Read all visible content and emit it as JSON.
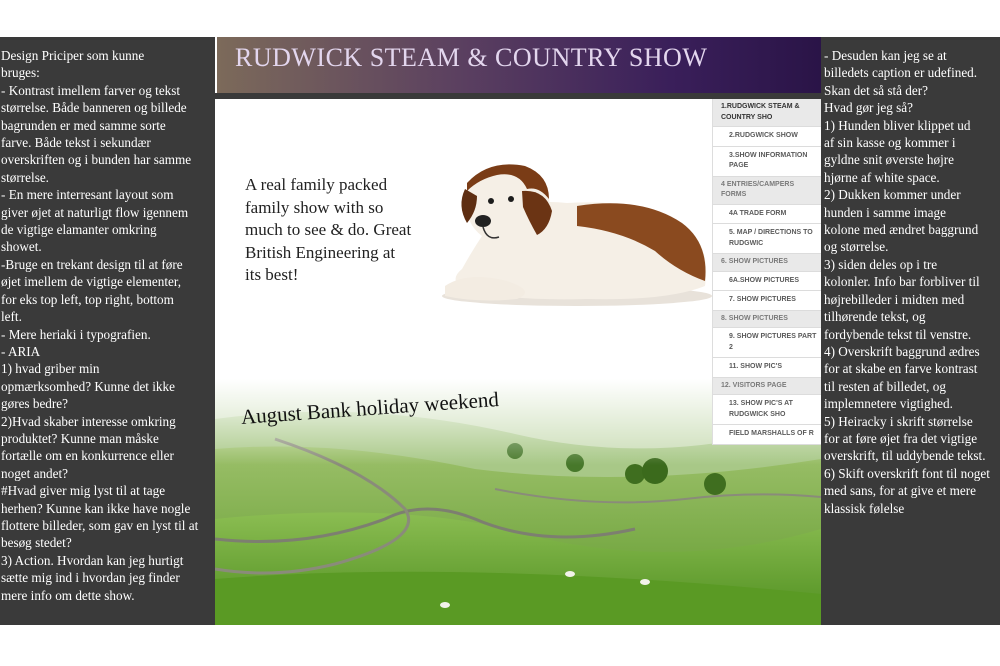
{
  "left_notes": {
    "text": "Design Priciper som kunne\nbruges:\n- Kontrast imellem farver og tekst\nstørrelse. Både banneren og billede\nbagrunden er med samme sorte\nfarve. Både tekst i sekundær\noverskriften og i bunden har samme\nstørrelse.\n- En mere interresant layout som\ngiver øjet at naturligt flow igennem\nde vigtige elamanter omkring\nshowet.\n-Bruge en trekant design til at føre\nøjet imellem de vigtige elementer,\nfor eks top left, top right, bottom\nleft.\n- Mere heriaki i typografien.\n- ARIA\n1) hvad griber min\nopmærksomhed? Kunne det ikke\ngøres bedre?\n2)Hvad skaber interesse omkring\nproduktet? Kunne man måske\nfortælle om en konkurrence eller\nnoget andet?\n#Hvad giver mig lyst til at tage\nherhen? Kunne kan ikke have nogle\nflottere billeder, som gav en lyst til at\nbesøg stedet?\n3) Action. Hvordan kan jeg hurtigt\nsætte mig ind i hvordan jeg finder\nmere info om dette show."
  },
  "right_notes": {
    "text": "- Desuden kan jeg se at\nbilledets caption er udefined.\nSkan det så stå der?\nHvad gør jeg så?\n1) Hunden bliver klippet ud\naf sin kasse og kommer i\ngyldne snit øverste højre\nhjørne af white space.\n2) Dukken kommer under\nhunden i samme image\nkolone med ændret baggrund\nog størrelse.\n3) siden deles op i tre\nkolonler. Info bar forbliver til\nhøjrebilleder i midten med\ntilhørende tekst, og\nfordybende tekst til venstre.\n4) Overskrift baggrund ædres\nfor at skabe en farve kontrast\ntil resten af billedet, og\nimplemnetere vigtighed.\n5) Heiracky i skrift størrelse\nfor at føre øjet fra det vigtige\noverskrift, til uddybende tekst.\n6) Skift overskrift font til noget\nmed sans, for at give et mere\nklassisk følelse"
  },
  "banner": {
    "title": "RUDWICK STEAM & COUNTRY SHOW"
  },
  "intro": {
    "text": "A real family packed family show with so much to see & do. Great British Engineering at its best!"
  },
  "headline": {
    "text": "August Bank holiday weekend"
  },
  "nav": {
    "items": [
      {
        "label": "1.RUDGWICK STEAM & COUNTRY SHO",
        "type": "section"
      },
      {
        "label": "2.RUDGWICK SHOW",
        "type": "sub"
      },
      {
        "label": "3.SHOW INFORMATION PAGE",
        "type": "sub"
      },
      {
        "label": "4 ENTRIES/CAMPERS FORMS",
        "type": "section"
      },
      {
        "label": "4a TRADE FORM",
        "type": "sub"
      },
      {
        "label": "5. MAP / DIRECTIONS TO RUDGWIC",
        "type": "sub"
      },
      {
        "label": "6. SHOW PICTURES",
        "type": "section"
      },
      {
        "label": "6a.SHOW PICTURES",
        "type": "sub"
      },
      {
        "label": "7. SHOW PICTURES",
        "type": "sub"
      },
      {
        "label": "8. SHOW PICTURES",
        "type": "section"
      },
      {
        "label": "9. SHOW PICTURES PART 2",
        "type": "sub"
      },
      {
        "label": "11. SHOW PIC'S",
        "type": "sub"
      },
      {
        "label": "12. VISITORS PAGE",
        "type": "section"
      },
      {
        "label": "13. SHOW PIC'S AT RUDGWICK SHO",
        "type": "sub"
      },
      {
        "label": "FIELD MARSHALLS OF R",
        "type": "sub"
      }
    ]
  },
  "images": {
    "dog": "st-bernard-dog",
    "landscape": "green-valley-landscape"
  }
}
